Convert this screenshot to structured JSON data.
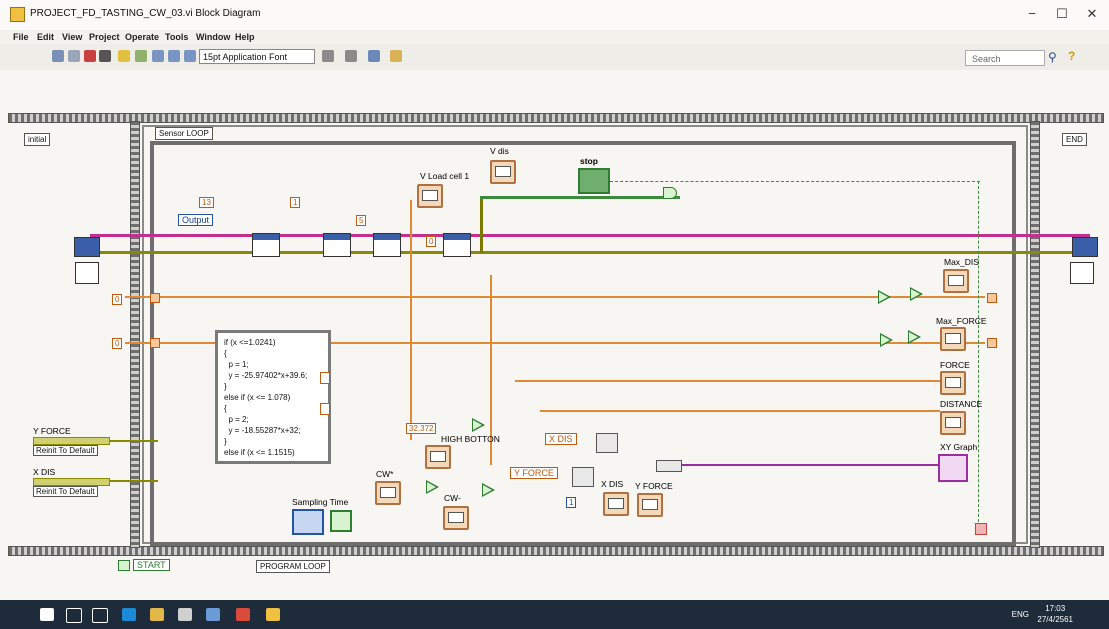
{
  "window": {
    "title": "PROJECT_FD_TASTING_CW_03.vi Block Diagram",
    "minimize": "−",
    "maximize": "☐",
    "close": "✕"
  },
  "menu": [
    "File",
    "Edit",
    "View",
    "Project",
    "Operate",
    "Tools",
    "Window",
    "Help"
  ],
  "toolbar": {
    "font": "15pt Application Font",
    "search_placeholder": "Search",
    "search_icon": "magnifier",
    "help_icon": "?"
  },
  "sequence": {
    "left_frame": "initial",
    "right_frame": "END",
    "sensor_loop": "Sensor LOOP",
    "program_loop": "PROGRAM LOOP",
    "start": "START"
  },
  "constants": {
    "c13": "13",
    "c1": "1",
    "c5": "5",
    "c0a": "0",
    "c0b": "0",
    "c0c": "0",
    "c32": "32.372",
    "c1b": "1",
    "output": "Output"
  },
  "indicators": {
    "vdis": "V dis",
    "vload": "V Load cell 1",
    "stop": "stop",
    "maxdis": "Max_DIS",
    "maxforce": "Max_FORCE",
    "force": "FORCE",
    "distance": "DISTANCE",
    "xygraph": "XY Graph",
    "highbotton": "HIGH BOTTON",
    "cwplus": "CW*",
    "cwminus": "CW-",
    "sampling": "Sampling Time",
    "xdis_b": "X DIS",
    "yforce_b": "Y FORCE"
  },
  "controls": {
    "yforce": "Y FORCE",
    "xdis": "X DIS",
    "reinit1": "Reinit To Default",
    "reinit2": "Reinit To Default",
    "xdis_prop": "X DIS",
    "yforce_prop": "Y FORCE"
  },
  "formula": "if (x <=1.0241)\n{\n  p = 1;\n  y = -25.97402*x+39.6;\n}\nelse if (x <= 1.078)\n{\n  p = 2;\n  y = -18.55287*x+32;\n}\nelse if (x <= 1.1515)",
  "taskbar": {
    "lang": "ENG",
    "time": "17:03",
    "date": "27/4/2561"
  }
}
